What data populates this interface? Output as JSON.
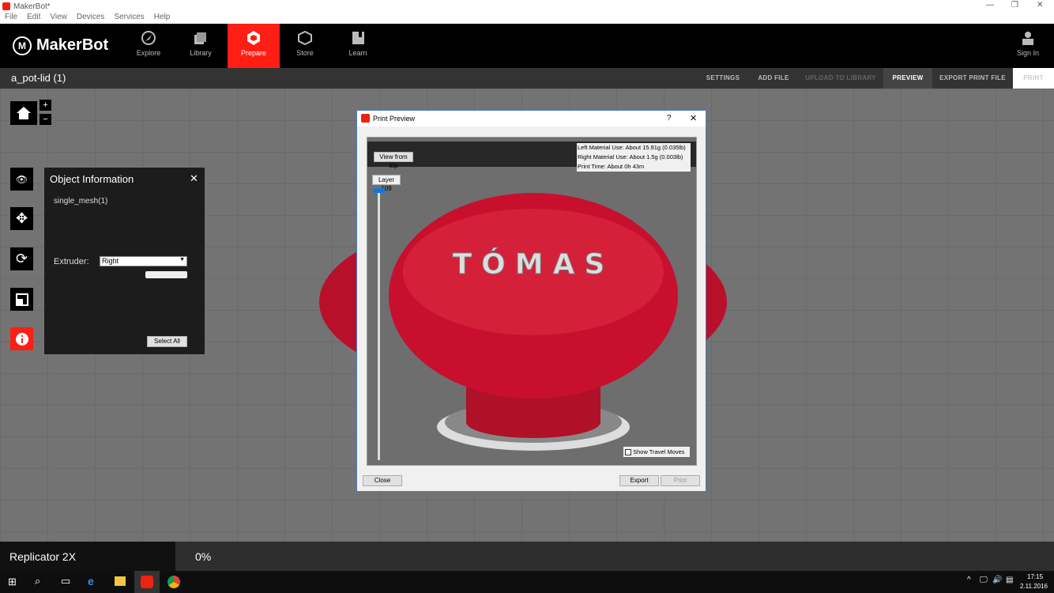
{
  "window": {
    "title": "MakerBot*",
    "menu": [
      "File",
      "Edit",
      "View",
      "Devices",
      "Services",
      "Help"
    ]
  },
  "nav": {
    "logo": "MakerBot",
    "items": [
      {
        "label": "Explore",
        "icon": "compass-icon"
      },
      {
        "label": "Library",
        "icon": "library-icon"
      },
      {
        "label": "Prepare",
        "icon": "prepare-icon",
        "active": true
      },
      {
        "label": "Store",
        "icon": "box-icon"
      },
      {
        "label": "Learn",
        "icon": "book-icon"
      }
    ],
    "sign_in": "Sign In"
  },
  "subbar": {
    "file_title": "a_pot-lid (1)",
    "settings": "SETTINGS",
    "add_file": "ADD FILE",
    "upload": "UPLOAD TO LIBRARY",
    "preview": "PREVIEW",
    "export": "EXPORT PRINT FILE",
    "print": "PRINT"
  },
  "object_info": {
    "title": "Object Information",
    "mesh": "single_mesh(1)",
    "extruder_label": "Extruder:",
    "extruder_value": "Right",
    "select_all": "Select All"
  },
  "dialog": {
    "title": "Print Preview",
    "help": "?",
    "view_top": "View from top",
    "layer": "Layer 109",
    "left_material": "Left Material Use: About 15.91g (0.035lb)",
    "right_material": "Right Material Use: About 1.5g (0.003lb)",
    "print_time": "Print Time: About 0h 43m",
    "show_travel": "Show Travel Moves",
    "close": "Close",
    "export": "Export",
    "print": "Print",
    "model_text": "TÓMAS"
  },
  "status": {
    "printer": "Replicator 2X",
    "progress": "0%"
  },
  "taskbar": {
    "time": "17:15",
    "date": "2.11.2016"
  },
  "colors": {
    "accent": "#ff1e14",
    "model": "#c8102e"
  }
}
